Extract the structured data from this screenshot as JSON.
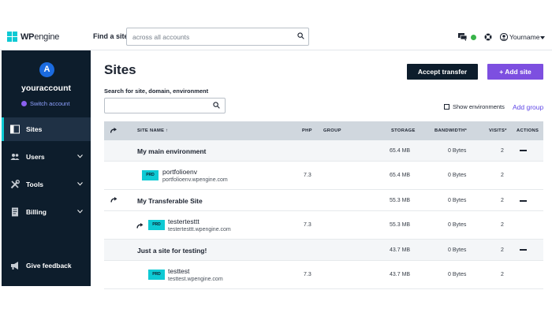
{
  "header": {
    "logo_bold": "WP",
    "logo_light": "engine",
    "find_label": "Find a site",
    "find_placeholder": "across all accounts",
    "username": "Yourname"
  },
  "sidebar": {
    "avatar_letter": "A",
    "account_name": "youraccount",
    "switch_account": "Switch account",
    "items": [
      {
        "label": "Sites",
        "icon": "sites-icon",
        "active": true
      },
      {
        "label": "Users",
        "icon": "users-icon"
      },
      {
        "label": "Tools",
        "icon": "tools-icon"
      },
      {
        "label": "Billing",
        "icon": "billing-icon"
      }
    ],
    "feedback": "Give feedback"
  },
  "main": {
    "title": "Sites",
    "accept_transfer": "Accept transfer",
    "add_site": "+ Add site",
    "search_label": "Search for site, domain, environment",
    "show_environments": "Show environments",
    "add_group": "Add group"
  },
  "table": {
    "headers": {
      "site_name": "SITE NAME ↑",
      "php": "PHP",
      "group": "GROUP",
      "storage": "STORAGE",
      "bandwidth": "BANDWIDTH*",
      "visits": "VISITS*",
      "actions": "ACTIONS"
    },
    "sites": [
      {
        "name": "My main environment",
        "storage": "65.4 MB",
        "bandwidth": "0 Bytes",
        "visits": "2",
        "env": {
          "badge": "PRD",
          "name": "portfolioenv",
          "domain": "portfolioenv.wpengine.com",
          "php": "7.3",
          "storage": "65.4 MB",
          "bandwidth": "0 Bytes",
          "visits": "2"
        }
      },
      {
        "name": "My Transferable Site",
        "storage": "55.3 MB",
        "bandwidth": "0 Bytes",
        "visits": "2",
        "env": {
          "badge": "PRD",
          "name": "testertesttt",
          "domain": "testertesttt.wpengine.com",
          "php": "7.3",
          "storage": "55.3 MB",
          "bandwidth": "0 Bytes",
          "visits": "2"
        }
      },
      {
        "name": "Just a site for testing!",
        "storage": "43.7 MB",
        "bandwidth": "0 Bytes",
        "visits": "2",
        "env": {
          "badge": "PRD",
          "name": "testtest",
          "domain": "testtest.wpengine.com",
          "php": "7.3",
          "storage": "43.7 MB",
          "bandwidth": "0 Bytes",
          "visits": "2"
        }
      }
    ]
  },
  "colors": {
    "sidebar_bg": "#0d1d2c",
    "accent_cyan": "#0ecad4",
    "accent_purple": "#7d4fe0",
    "link_purple": "#5f47e6",
    "status_green": "#38b349"
  }
}
